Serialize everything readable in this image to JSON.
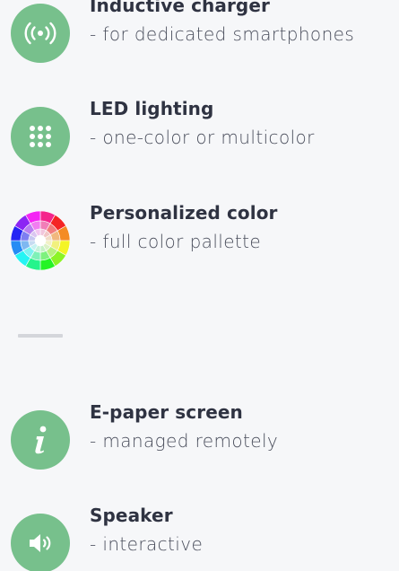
{
  "features_top": [
    {
      "id": "inductive-charger",
      "icon": "wireless-signal-icon",
      "title": "Inductive charger",
      "subtitle": "- for dedicated smartphones"
    },
    {
      "id": "led-lighting",
      "icon": "led-grid-icon",
      "title": "LED lighting",
      "subtitle": "- one-color or multicolor"
    },
    {
      "id": "personalized-color",
      "icon": "color-wheel-icon",
      "title": "Personalized color",
      "subtitle": "- full color pallette"
    }
  ],
  "features_bottom": [
    {
      "id": "e-paper-screen",
      "icon": "info-icon",
      "title": "E-paper screen",
      "subtitle": "- managed remotely"
    },
    {
      "id": "speaker",
      "icon": "speaker-icon",
      "title": "Speaker",
      "subtitle": "- interactive"
    }
  ],
  "colors": {
    "icon_bg": "#77c08c",
    "title": "#2f3342",
    "subtitle": "#4a4e5c",
    "divider": "#d4d6db",
    "background": "#f6f7f9"
  }
}
